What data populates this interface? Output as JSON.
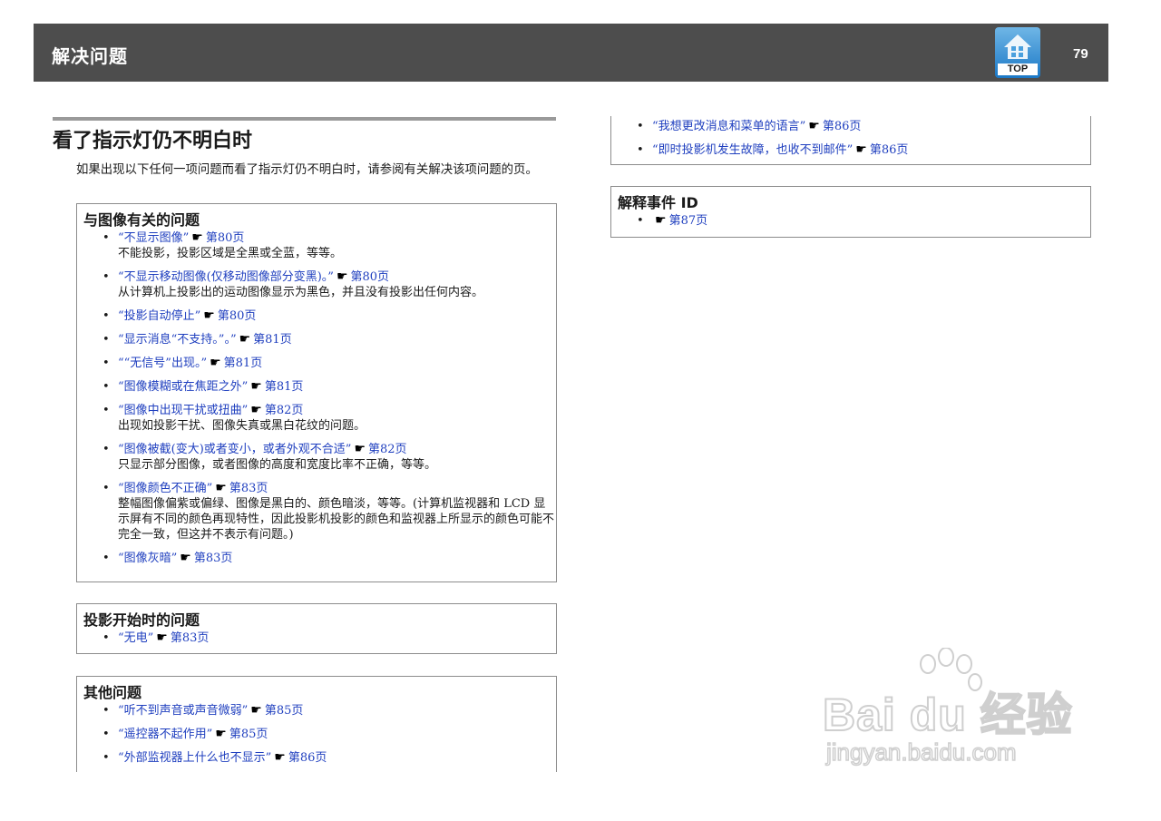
{
  "header": {
    "title": "解决问题",
    "page_number": "79",
    "top_button_label": "TOP"
  },
  "section": {
    "title": "看了指示灯仍不明白时",
    "intro": "如果出现以下任何一项问题而看了指示灯仍不明白时，请参阅有关解决该项问题的页。"
  },
  "boxes": {
    "image": {
      "title": "与图像有关的问题",
      "items": [
        {
          "link": "“不显示图像”",
          "page": "第80页",
          "desc": "不能投影，投影区域是全黑或全蓝，等等。"
        },
        {
          "link": "“不显示移动图像(仅移动图像部分变黑)。”",
          "page": "第80页",
          "desc": "从计算机上投影出的运动图像显示为黑色，并且没有投影出任何内容。"
        },
        {
          "link": "“投影自动停止”",
          "page": "第80页",
          "desc": ""
        },
        {
          "link": "“显示消息“不支持。”。”",
          "page": "第81页",
          "desc": ""
        },
        {
          "link": "““无信号”出现。”",
          "page": "第81页",
          "desc": ""
        },
        {
          "link": "“图像模糊或在焦距之外”",
          "page": "第81页",
          "desc": ""
        },
        {
          "link": "“图像中出现干扰或扭曲”",
          "page": "第82页",
          "desc": "出现如投影干扰、图像失真或黑白花纹的问题。"
        },
        {
          "link": "“图像被截(变大)或者变小，或者外观不合适”",
          "page": "第82页",
          "desc": "只显示部分图像，或者图像的高度和宽度比率不正确，等等。"
        },
        {
          "link": "“图像颜色不正确”",
          "page": "第83页",
          "desc": "整幅图像偏紫或偏绿、图像是黑白的、颜色暗淡，等等。(计算机监视器和 LCD 显示屏有不同的颜色再现特性，因此投影机投影的颜色和监视器上所显示的颜色可能不完全一致，但这并不表示有问题。)"
        },
        {
          "link": "“图像灰暗”",
          "page": "第83页",
          "desc": ""
        }
      ]
    },
    "start": {
      "title": "投影开始时的问题",
      "items": [
        {
          "link": "“无电”",
          "page": "第83页",
          "desc": ""
        }
      ]
    },
    "other": {
      "title": "其他问题",
      "items": [
        {
          "link": "“听不到声音或声音微弱”",
          "page": "第85页",
          "desc": ""
        },
        {
          "link": "“遥控器不起作用”",
          "page": "第85页",
          "desc": ""
        },
        {
          "link": "“外部监视器上什么也不显示”",
          "page": "第86页",
          "desc": ""
        }
      ],
      "items_continued": [
        {
          "link": "“我想更改消息和菜单的语言”",
          "page": "第86页",
          "desc": ""
        },
        {
          "link": "“即时投影机发生故障，也收不到邮件”",
          "page": "第86页",
          "desc": ""
        }
      ]
    },
    "event": {
      "title": "解释事件 ID",
      "items": [
        {
          "link": "",
          "page": "第87页",
          "desc": ""
        }
      ]
    }
  },
  "watermark": {
    "logo": "Bai du 经验",
    "url": "jingyan.baidu.com"
  },
  "colors": {
    "header_bg": "#4d4d4d",
    "link": "#1f3fbf",
    "top_button": "#1b78c6"
  },
  "icons": {
    "reference": "pointing-hand-icon",
    "top": "home-icon"
  }
}
